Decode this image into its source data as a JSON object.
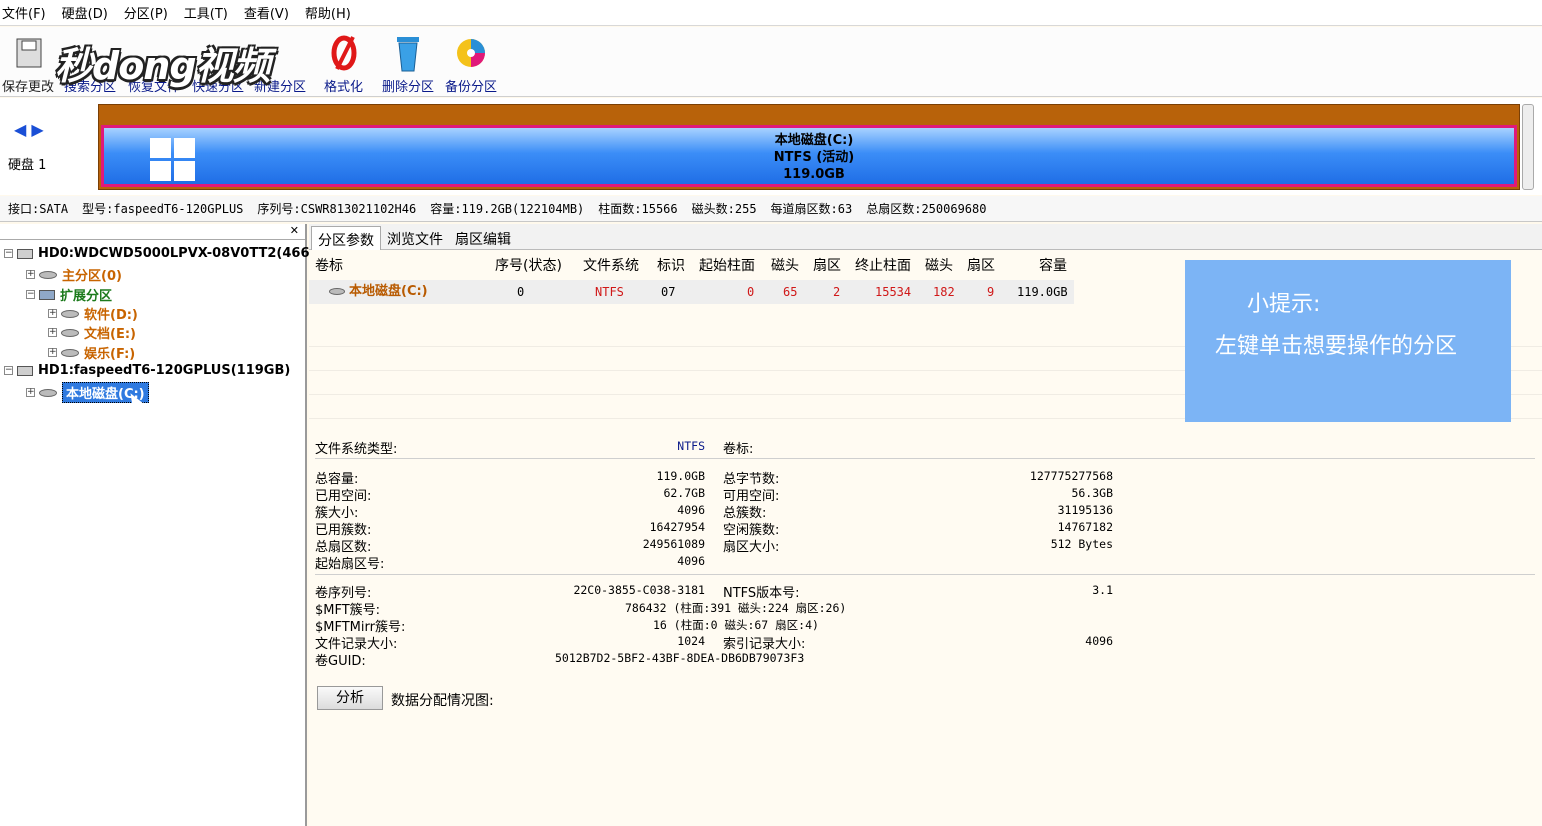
{
  "menu": [
    "文件(F)",
    "硬盘(D)",
    "分区(P)",
    "工具(T)",
    "查看(V)",
    "帮助(H)"
  ],
  "toolbar": {
    "save": "保存更改",
    "search": "搜索分区",
    "recover": "恢复文件",
    "quick": "快速分区",
    "new": "新建分区",
    "format": "格式化",
    "delete": "删除分区",
    "backup": "备份分区",
    "logo_text": "秒dong视频"
  },
  "diskbar": {
    "disk_label": "硬盘 1",
    "part_name": "本地磁盘(C:)",
    "part_fs": "NTFS (活动)",
    "part_size": "119.0GB"
  },
  "diskinfo": {
    "interface": "接口:SATA",
    "model": "型号:faspeedT6-120GPLUS",
    "serial": "序列号:CSWR813021102H46",
    "capacity": "容量:119.2GB(122104MB)",
    "cylinders": "柱面数:15566",
    "heads": "磁头数:255",
    "sectors_per_track": "每道扇区数:63",
    "total_sectors": "总扇区数:250069680"
  },
  "tree": {
    "hd0": "HD0:WDCWD5000LPVX-08V0TT2(466GB)",
    "primary": "主分区(0)",
    "extended": "扩展分区",
    "software": "软件(D:)",
    "docs": "文档(E:)",
    "fun": "娱乐(F:)",
    "hd1": "HD1:faspeedT6-120GPLUS(119GB)",
    "local": "本地磁盘(C:)"
  },
  "tabs": [
    "分区参数",
    "浏览文件",
    "扇区编辑"
  ],
  "table": {
    "headers": [
      "卷标",
      "序号(状态)",
      "文件系统",
      "标识",
      "起始柱面",
      "磁头",
      "扇区",
      "终止柱面",
      "磁头",
      "扇区",
      "容量"
    ],
    "row": [
      "本地磁盘(C:)",
      "0",
      "NTFS",
      "07",
      "0",
      "65",
      "2",
      "15534",
      "182",
      "9",
      "119.0GB"
    ]
  },
  "tip": {
    "title": "小提示:",
    "body": "左键单击想要操作的分区"
  },
  "details": {
    "fs_type_label": "文件系统类型:",
    "fs_type": "NTFS",
    "vol_label": "卷标:",
    "total_cap_label": "总容量:",
    "total_cap": "119.0GB",
    "total_bytes_label": "总字节数:",
    "total_bytes": "127775277568",
    "used_label": "已用空间:",
    "used": "62.7GB",
    "free_label": "可用空间:",
    "free": "56.3GB",
    "cluster_label": "簇大小:",
    "cluster": "4096",
    "total_clusters_label": "总簇数:",
    "total_clusters": "31195136",
    "used_clusters_label": "已用簇数:",
    "used_clusters": "16427954",
    "free_clusters_label": "空闲簇数:",
    "free_clusters": "14767182",
    "total_sectors_label": "总扇区数:",
    "total_sectors": "249561089",
    "sector_size_label": "扇区大小:",
    "sector_size": "512 Bytes",
    "start_sector_label": "起始扇区号:",
    "start_sector": "4096",
    "vol_serial_label": "卷序列号:",
    "vol_serial": "22C0-3855-C038-3181",
    "ntfs_ver_label": "NTFS版本号:",
    "ntfs_ver": "3.1",
    "mft_label": "$MFT簇号:",
    "mft": "786432 (柱面:391 磁头:224 扇区:26)",
    "mftmirr_label": "$MFTMirr簇号:",
    "mftmirr": "16 (柱面:0 磁头:67 扇区:4)",
    "file_rec_label": "文件记录大小:",
    "file_rec": "1024",
    "index_rec_label": "索引记录大小:",
    "index_rec": "4096",
    "guid_label": "卷GUID:",
    "guid": "5012B7D2-5BF2-43BF-8DEA-DB6DB79073F3"
  },
  "analyze_button": "分析",
  "map_label": "数据分配情况图:"
}
